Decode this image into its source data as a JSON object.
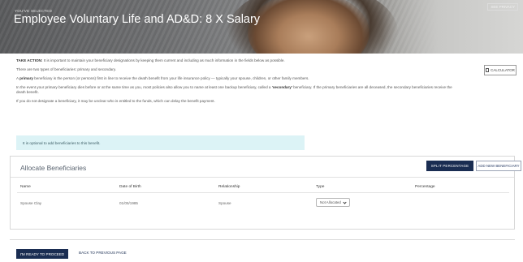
{
  "hero": {
    "kicker": "YOU'VE SELECTED",
    "title": "Employee Voluntary Life and AD&D: 8 X Salary",
    "top_link": "SEE PRIVACY"
  },
  "content": {
    "take_action_label": "TAKE ACTION:",
    "take_action_text": " It is important to maintain your beneficiary designations by keeping them current and including as much information in the fields below as possible.",
    "p2": "There are two types of beneficiaries: primary and secondary.",
    "p3_pre": "A ",
    "p3_bold": "primary",
    "p3_post": " beneficiary is the person (or persons) first in line to receive the death benefit from your life insurance policy — typically your spouse, children, or other family members.",
    "p4_pre": "In the event your primary beneficiary dies before or at the same time as you, most policies also allow you to name at least one backup beneficiary, called a ",
    "p4_bold": "'secondary'",
    "p4_post": " beneficiary. If the primary beneficiaries are all deceased, the secondary beneficiaries receive the death benefit.",
    "p5": "If you do not designate a beneficiary, it may be unclear who is entitled to the funds, which can delay the benefit payment."
  },
  "calculator_label": "CALCULATOR",
  "info_text": "It is optional to add beneficiaries to this benefit.",
  "allocate": {
    "title": "Allocate Beneficiaries",
    "split_label": "SPLIT PERCENTAGE",
    "add_label": "ADD NEW BENEFICIARY",
    "columns": [
      "Name",
      "Date of Birth",
      "Relationship",
      "Type",
      "Percentage"
    ],
    "row": {
      "name": "Spouse Clay",
      "dob": "01/05/1985",
      "relationship": "Spouse",
      "type": "Not Allocated"
    }
  },
  "footer": {
    "proceed_label": "I'M READY TO PROCEED",
    "back_label": "BACK TO PREVIOUS PAGE"
  }
}
